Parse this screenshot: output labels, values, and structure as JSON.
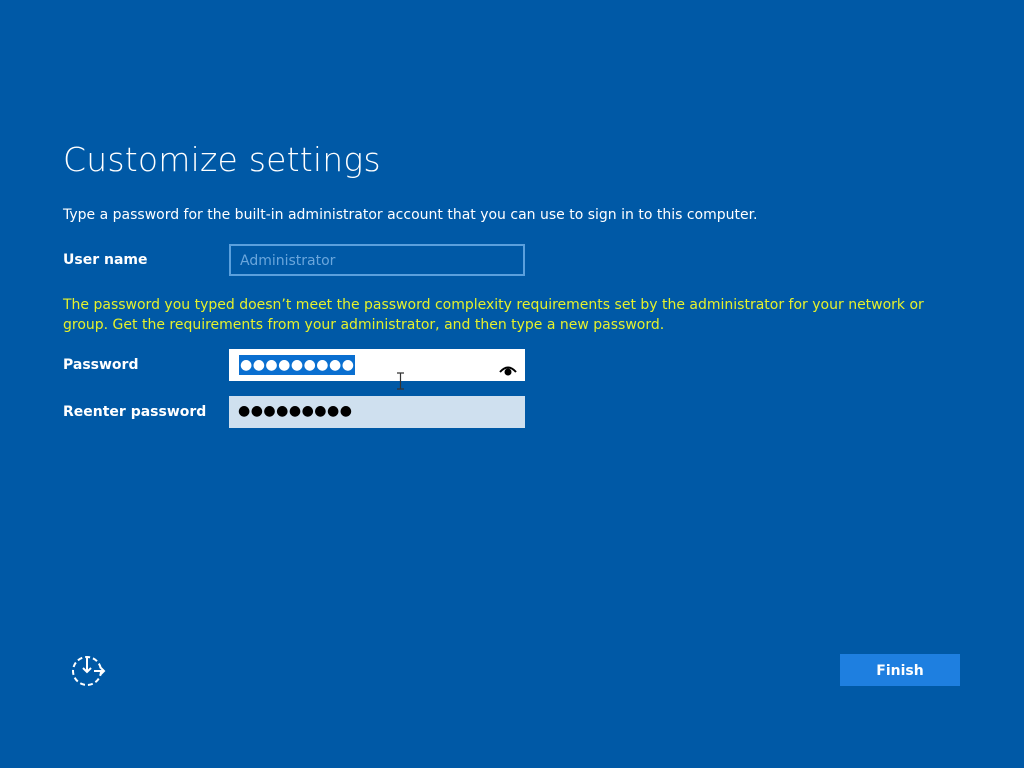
{
  "page": {
    "title": "Customize settings",
    "instruction": "Type a password for the built-in administrator account that you can use to sign in to this computer."
  },
  "form": {
    "username_label": "User name",
    "username_placeholder": "Administrator",
    "warning": "The password you typed doesn’t meet the password complexity requirements set by the administrator for your network or group. Get the requirements from your administrator, and then type a new password.",
    "password_label": "Password",
    "password_mask": "●●●●●●●●●",
    "reenter_label": "Reenter password",
    "reenter_mask": "●●●●●●●●●"
  },
  "footer": {
    "finish_label": "Finish"
  },
  "icons": {
    "reveal": "eye-icon",
    "accessibility": "ease-of-access-icon"
  },
  "colors": {
    "background": "#0059a6",
    "warning": "#e6f12b",
    "button": "#1e7fe0",
    "field_border": "#5ba0dd"
  }
}
